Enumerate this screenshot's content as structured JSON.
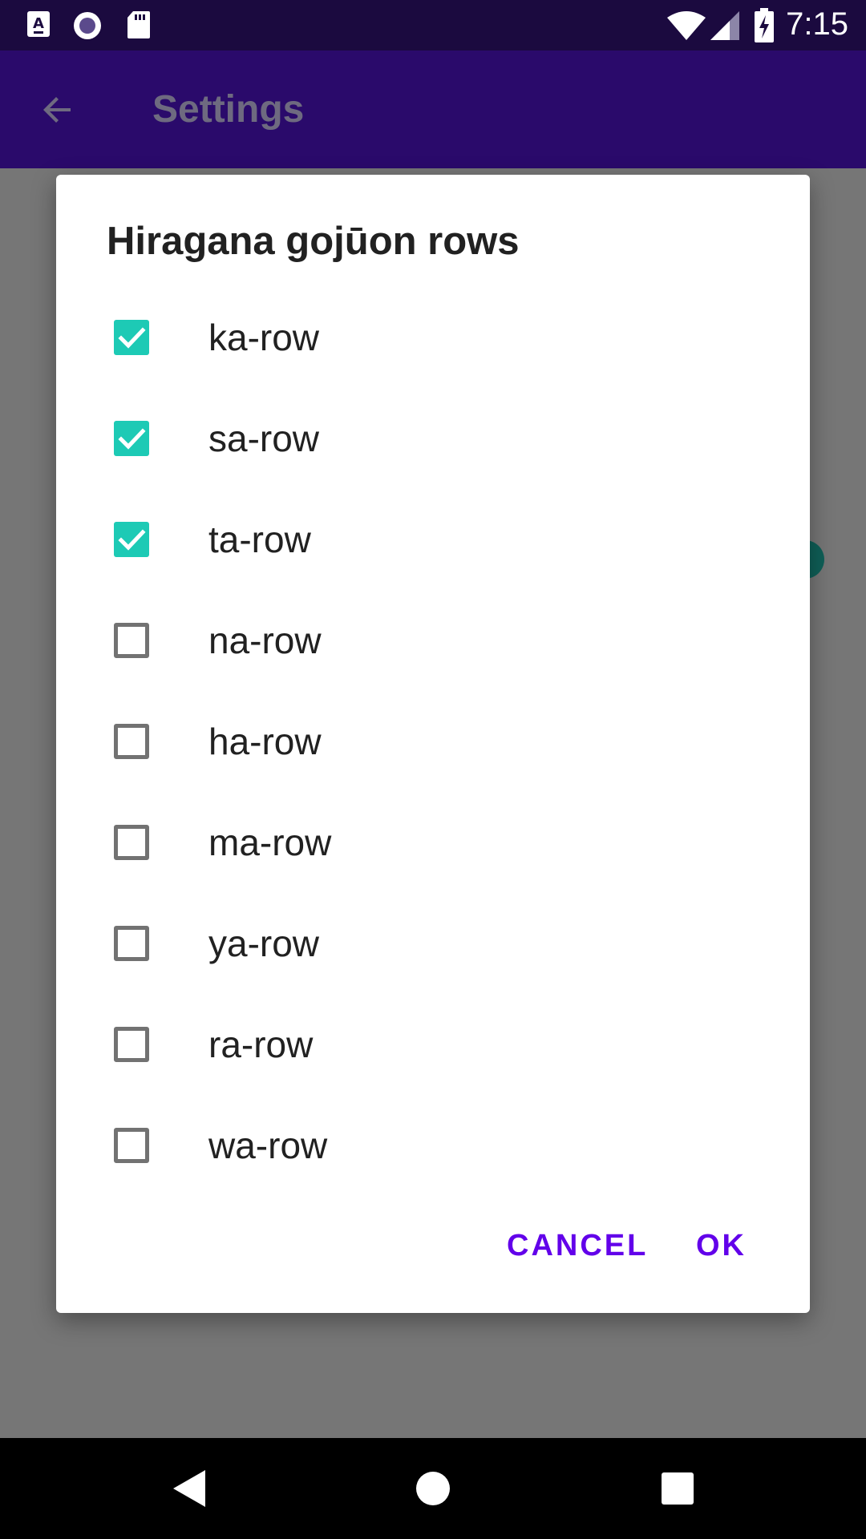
{
  "status_bar": {
    "time": "7:15",
    "icons": [
      "keyboard-a-icon",
      "radio-icon",
      "sd-card-icon",
      "wifi-icon",
      "signal-icon",
      "battery-charging-icon"
    ]
  },
  "app_bar": {
    "title": "Settings",
    "back_icon": "arrow-back-icon"
  },
  "dialog": {
    "title": "Hiragana gojūon rows",
    "options": [
      {
        "label": "ka-row",
        "checked": true
      },
      {
        "label": "sa-row",
        "checked": true
      },
      {
        "label": "ta-row",
        "checked": true
      },
      {
        "label": "na-row",
        "checked": false
      },
      {
        "label": "ha-row",
        "checked": false
      },
      {
        "label": "ma-row",
        "checked": false
      },
      {
        "label": "ya-row",
        "checked": false
      },
      {
        "label": "ra-row",
        "checked": false
      },
      {
        "label": "wa-row",
        "checked": false
      }
    ],
    "cancel_label": "CANCEL",
    "ok_label": "OK"
  },
  "colors": {
    "accent": "#1dcab5",
    "button": "#6200ea",
    "app_bar": "#2a0a6b",
    "status_bar": "#1b0a3f"
  },
  "nav_bar": {
    "icons": [
      "back-triangle-icon",
      "home-circle-icon",
      "recents-square-icon"
    ]
  }
}
